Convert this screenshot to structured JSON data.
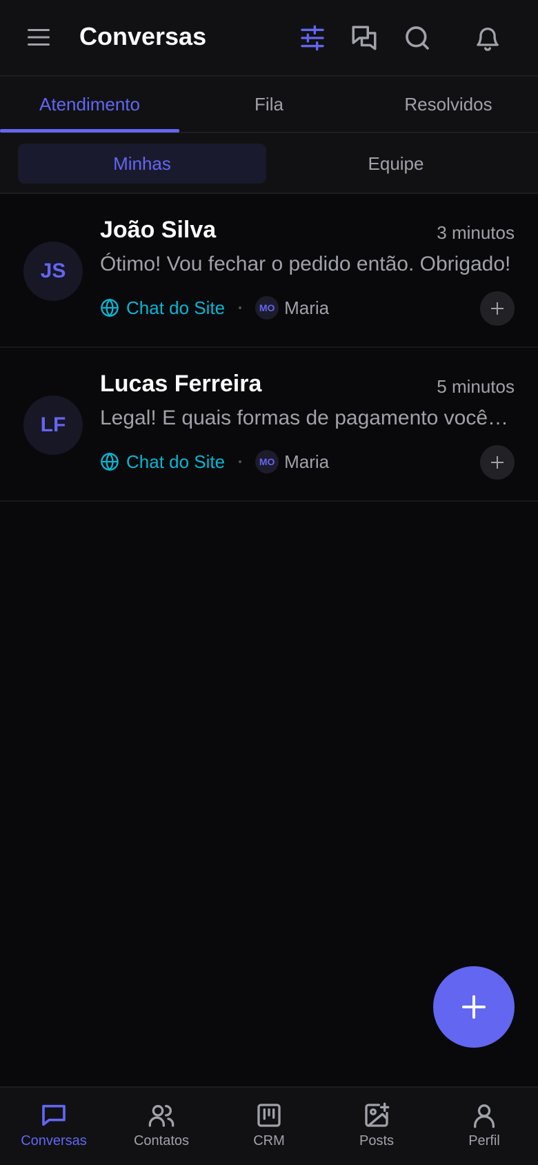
{
  "header": {
    "title": "Conversas",
    "icons": [
      "menu-icon",
      "filter-sliders-icon",
      "chats-icon",
      "search-icon",
      "bell-icon"
    ]
  },
  "tabs": [
    {
      "label": "Atendimento",
      "active": true
    },
    {
      "label": "Fila",
      "active": false
    },
    {
      "label": "Resolvidos",
      "active": false
    }
  ],
  "segments": [
    {
      "label": "Minhas",
      "active": true
    },
    {
      "label": "Equipe",
      "active": false
    }
  ],
  "conversations": [
    {
      "initials": "JS",
      "name": "João Silva",
      "time": "3 minutos",
      "message": "Ótimo! Vou fechar o pedido então. Obrigado!",
      "channel": "Chat do Site",
      "agent_initials": "MO",
      "agent": "Maria"
    },
    {
      "initials": "LF",
      "name": "Lucas Ferreira",
      "time": "5 minutos",
      "message": "Legal! E quais formas de pagamento vocês aceitam?",
      "channel": "Chat do Site",
      "agent_initials": "MO",
      "agent": "Maria"
    }
  ],
  "bottom_nav": [
    {
      "label": "Conversas",
      "icon": "chat-bubble-icon",
      "active": true
    },
    {
      "label": "Contatos",
      "icon": "users-icon",
      "active": false
    },
    {
      "label": "CRM",
      "icon": "kanban-icon",
      "active": false
    },
    {
      "label": "Posts",
      "icon": "image-plus-icon",
      "active": false
    },
    {
      "label": "Perfil",
      "icon": "user-icon",
      "active": false
    }
  ],
  "colors": {
    "accent": "#6366f1",
    "channel": "#06b6d4",
    "background": "#09090b",
    "surface": "#111114",
    "muted_text": "#a1a1aa"
  }
}
